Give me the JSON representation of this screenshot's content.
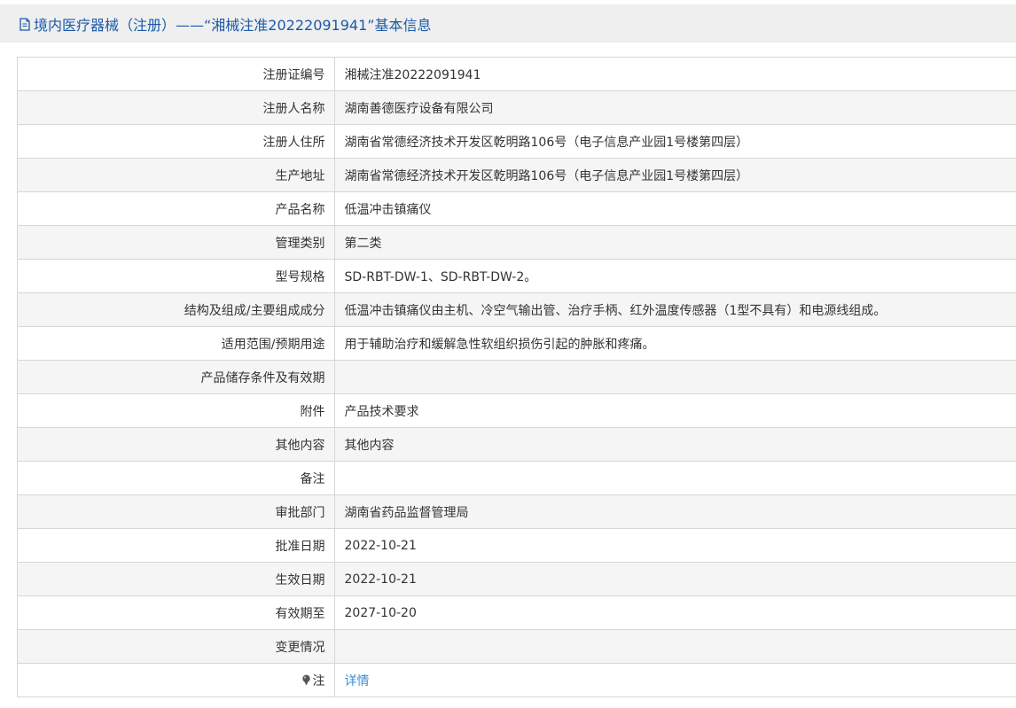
{
  "header": {
    "title": "境内医疗器械（注册）——“湘械注准20222091941”基本信息",
    "icon": "document-icon",
    "color": "#1a5aa8"
  },
  "rows": [
    {
      "label": "注册证编号",
      "value": "湘械注准20222091941"
    },
    {
      "label": "注册人名称",
      "value": "湖南善德医疗设备有限公司"
    },
    {
      "label": "注册人住所",
      "value": "湖南省常德经济技术开发区乾明路106号（电子信息产业园1号楼第四层）"
    },
    {
      "label": "生产地址",
      "value": "湖南省常德经济技术开发区乾明路106号（电子信息产业园1号楼第四层）"
    },
    {
      "label": "产品名称",
      "value": "低温冲击镇痛仪"
    },
    {
      "label": "管理类别",
      "value": "第二类"
    },
    {
      "label": "型号规格",
      "value": "SD-RBT-DW-1、SD-RBT-DW-2。"
    },
    {
      "label": "结构及组成/主要组成成分",
      "value": "低温冲击镇痛仪由主机、冷空气输出管、治疗手柄、红外温度传感器（1型不具有）和电源线组成。"
    },
    {
      "label": "适用范围/预期用途",
      "value": "用于辅助治疗和缓解急性软组织损伤引起的肿胀和疼痛。"
    },
    {
      "label": "产品储存条件及有效期",
      "value": ""
    },
    {
      "label": "附件",
      "value": "产品技术要求"
    },
    {
      "label": "其他内容",
      "value": "其他内容"
    },
    {
      "label": "备注",
      "value": ""
    },
    {
      "label": "审批部门",
      "value": "湖南省药品监督管理局"
    },
    {
      "label": "批准日期",
      "value": "2022-10-21"
    },
    {
      "label": "生效日期",
      "value": "2022-10-21"
    },
    {
      "label": "有效期至",
      "value": "2027-10-20"
    },
    {
      "label": "变更情况",
      "value": ""
    },
    {
      "label": "注",
      "value": "详情",
      "icon": "pin-icon"
    }
  ],
  "colors": {
    "link": "#3a8cd6",
    "alt_row": "#f5f5f5",
    "border": "#d6d6d6",
    "header_bg": "#efefef"
  }
}
